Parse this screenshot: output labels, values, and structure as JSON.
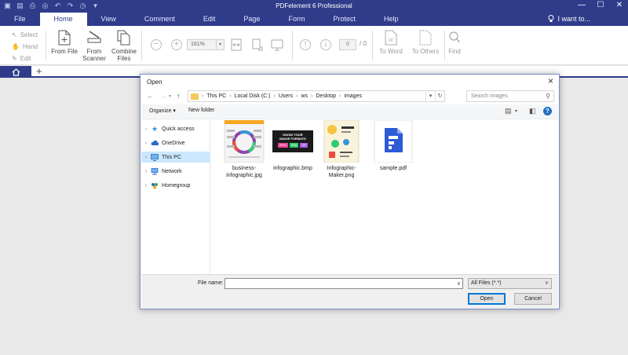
{
  "app": {
    "title": "PDFelement 6 Professional"
  },
  "window_controls": {
    "minimize": "—",
    "maximize": "☐",
    "close": "✕"
  },
  "menu": {
    "tabs": [
      "File",
      "Home",
      "View",
      "Comment",
      "Edit",
      "Page",
      "Form",
      "Protect",
      "Help"
    ],
    "active": "Home",
    "iwant": "I want to..."
  },
  "ribbon": {
    "select": "Select",
    "hand": "Hand",
    "edit": "Edit",
    "from_file": "From File",
    "from_scanner": "From Scanner",
    "combine_files": "Combine Files",
    "zoom": "161%",
    "page_current": "0",
    "page_total": "/ 0",
    "to_word": "To Word",
    "to_others": "To Others",
    "find": "Find"
  },
  "dialog": {
    "title": "Open",
    "breadcrumb": [
      "This PC",
      "Local Disk (C:)",
      "Users",
      "ws",
      "Desktop",
      "images"
    ],
    "search_placeholder": "Search images",
    "organize": "Organize ▾",
    "new_folder": "New folder",
    "nav": [
      {
        "label": "Quick access",
        "icon": "star-icon"
      },
      {
        "label": "OneDrive",
        "icon": "cloud-icon"
      },
      {
        "label": "This PC",
        "icon": "computer-icon",
        "selected": true
      },
      {
        "label": "Network",
        "icon": "network-icon"
      },
      {
        "label": "Homegroup",
        "icon": "homegroup-icon"
      }
    ],
    "files": [
      {
        "name": "business-infographic.jpg"
      },
      {
        "name": "infographic.bmp",
        "thumb_text": [
          "KNOW YOUR",
          "IMAGE FORMATS"
        ],
        "badges": [
          "JPEG",
          "PNG",
          "GIF"
        ]
      },
      {
        "name": "Infographic-Maker.png"
      },
      {
        "name": "sample.pdf"
      }
    ],
    "file_name_label": "File name:",
    "file_name_value": "",
    "file_type": "All Files (*.*)",
    "open_label": "Open",
    "cancel_label": "Cancel"
  },
  "colors": {
    "brand": "#2f3c8a",
    "pdf_blue": "#2e5bd6",
    "selection": "#cce8ff"
  }
}
